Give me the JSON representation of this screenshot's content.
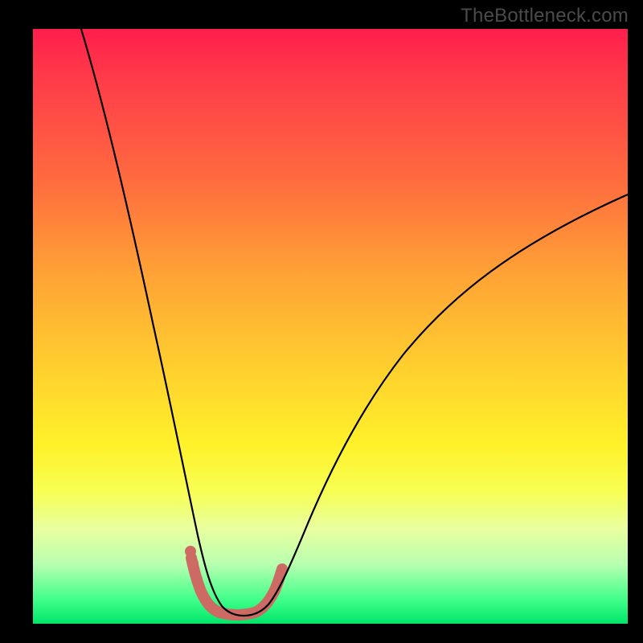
{
  "watermark": "TheBottleneck.com",
  "colors": {
    "background": "#000000",
    "curve": "#000000",
    "highlight": "#cc6a63",
    "gradient_top": "#ff1e4b",
    "gradient_bottom": "#00e56a"
  },
  "chart_data": {
    "type": "line",
    "title": "",
    "xlabel": "",
    "ylabel": "",
    "xlim": [
      0,
      100
    ],
    "ylim": [
      0,
      100
    ],
    "grid": false,
    "series": [
      {
        "name": "left_branch",
        "x": [
          12,
          14,
          16,
          18,
          20,
          22,
          24,
          25,
          26,
          27,
          28,
          29,
          30
        ],
        "y": [
          100,
          88,
          76,
          64,
          52,
          40,
          27,
          20,
          14,
          9.5,
          6,
          3.5,
          2
        ]
      },
      {
        "name": "right_branch",
        "x": [
          38,
          40,
          42,
          45,
          50,
          55,
          60,
          65,
          70,
          75,
          80,
          85,
          90,
          95,
          100
        ],
        "y": [
          2,
          4,
          8,
          14,
          24,
          32,
          39,
          45,
          50,
          55,
          59,
          63,
          66.5,
          69.5,
          72
        ]
      },
      {
        "name": "valley_floor",
        "x": [
          30,
          32,
          34,
          36,
          38
        ],
        "y": [
          2,
          1.4,
          1.3,
          1.4,
          2
        ]
      }
    ],
    "highlight_region": {
      "note": "Salmon overdraw near valley where bottleneck is acceptable",
      "x": [
        27,
        28,
        29,
        30,
        31,
        33,
        35,
        37,
        39,
        40,
        41
      ],
      "y": [
        10,
        6,
        3.5,
        2.2,
        2.0,
        1.6,
        1.6,
        1.8,
        2.6,
        4,
        7
      ]
    }
  }
}
